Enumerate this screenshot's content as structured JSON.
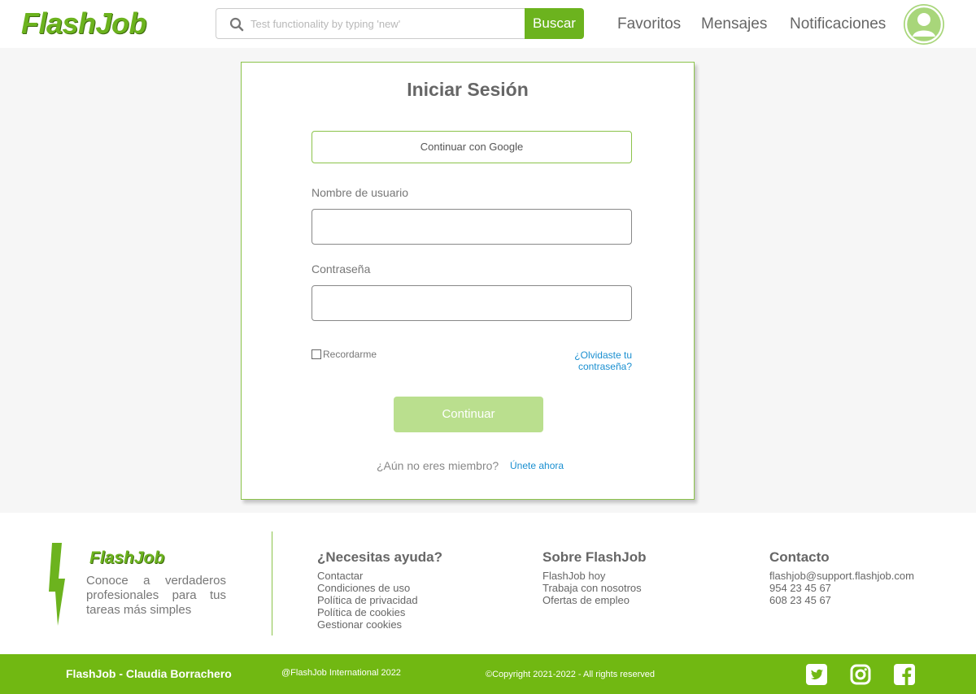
{
  "header": {
    "logo": "FlashJob",
    "search_placeholder": "Test functionality by typing 'new'",
    "search_button": "Buscar",
    "nav": [
      "Favoritos",
      "Mensajes",
      "Notificaciones"
    ]
  },
  "login": {
    "title": "Iniciar Sesión",
    "google_button": "Continuar con Google",
    "username_label": "Nombre de usuario",
    "password_label": "Contraseña",
    "remember_label": "Recordarme",
    "forgot_link": "¿Olvidaste tu contraseña?",
    "continue_button": "Continuar",
    "member_prompt": "¿Aún no eres miembro?",
    "join_link": "Únete ahora"
  },
  "footer": {
    "logo": "FlashJob",
    "description": "Conoce a verdaderos profesionales para tus tareas más simples",
    "help": {
      "title": "¿Necesitas ayuda?",
      "links": [
        "Contactar",
        "Condiciones de uso",
        "Política de privacidad",
        "Política de cookies",
        "Gestionar cookies"
      ]
    },
    "about": {
      "title": "Sobre FlashJob",
      "links": [
        "FlashJob hoy",
        "Trabaja con nosotros",
        "Ofertas de empleo"
      ]
    },
    "contact": {
      "title": "Contacto",
      "links": [
        "flashjob@support.flashjob.com",
        "954 23 45 67",
        "608 23 45 67"
      ]
    }
  },
  "bottom_bar": {
    "author": "FlashJob - Claudia Borrachero",
    "international": "@FlashJob International 2022",
    "copyright": "©Copyright  2021-2022 - All rights reserved",
    "social_icons": [
      "twitter-icon",
      "instagram-icon",
      "facebook-icon"
    ]
  },
  "colors": {
    "brand_green": "#6cb31e",
    "bar_green": "#71b812",
    "button_disabled_green": "#badf8e",
    "link_blue": "#1a8fd0"
  }
}
